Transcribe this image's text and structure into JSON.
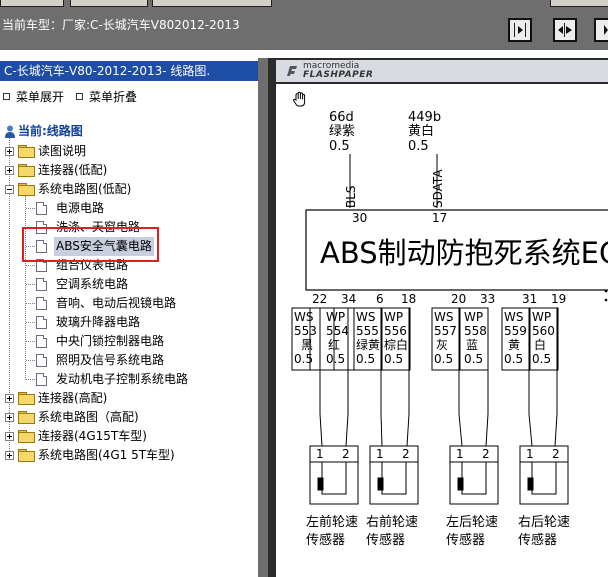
{
  "top": {
    "vehicle_text": "当前车型：厂家:C-长城汽车V802012-2013"
  },
  "tree": {
    "header": "C-长城汽车-V80-2012-2013- 线路图.",
    "expand_all": "菜单展开",
    "collapse_all": "菜单折叠",
    "current": "当前:线路图",
    "items": [
      {
        "label": "读图说明"
      },
      {
        "label": "连接器(低配)"
      },
      {
        "label": "系统电路图(低配)"
      },
      {
        "label": "电源电路"
      },
      {
        "label": "洗涤、天窗电路"
      },
      {
        "label": "ABS安全气囊电路"
      },
      {
        "label": "组合仪表电路"
      },
      {
        "label": "空调系统电路"
      },
      {
        "label": "音响、电动后视镜电路"
      },
      {
        "label": "玻璃升降器电路"
      },
      {
        "label": "中央门锁控制器电路"
      },
      {
        "label": "照明及信号系统电路"
      },
      {
        "label": "发动机电子控制系统电路"
      },
      {
        "label": "连接器(高配)"
      },
      {
        "label": "系统电路图（高配)"
      },
      {
        "label": "连接器(4G15T车型)"
      },
      {
        "label": "系统电路图(4G1 5T车型)"
      }
    ]
  },
  "viewer": {
    "brand_top": "macromedia",
    "brand_bottom": "FLASHPAPER"
  },
  "diagram": {
    "module_title": "ABS制动防抱死系统EC",
    "top_wires": [
      {
        "num": "66d",
        "color": "绿紫",
        "gauge": "0.5",
        "signal": "BLS",
        "pin": "30"
      },
      {
        "num": "449b",
        "color": "黄白",
        "gauge": "0.5",
        "signal": "SDATA",
        "pin": "17"
      }
    ],
    "bottom_pins": [
      "22",
      "34",
      "6",
      "18",
      "20",
      "33",
      "31",
      "19"
    ],
    "wires": [
      {
        "type": "WS",
        "num": "553",
        "color": "黑",
        "gauge": "0.5"
      },
      {
        "type": "WP",
        "num": "554",
        "color": "红",
        "gauge": "0.5"
      },
      {
        "type": "WS",
        "num": "555",
        "color": "绿黄",
        "gauge": "0.5"
      },
      {
        "type": "WP",
        "num": "556",
        "color": "棕白",
        "gauge": "0.5"
      },
      {
        "type": "WS",
        "num": "557",
        "color": "灰",
        "gauge": "0.5"
      },
      {
        "type": "WP",
        "num": "558",
        "color": "蓝",
        "gauge": "0.5"
      },
      {
        "type": "WS",
        "num": "559",
        "color": "黄",
        "gauge": "0.5"
      },
      {
        "type": "WP",
        "num": "560",
        "color": "白",
        "gauge": "0.5"
      }
    ],
    "sensor_pins": [
      "1",
      "2"
    ],
    "sensors": [
      {
        "line1": "左前轮速",
        "line2": "传感器"
      },
      {
        "line1": "右前轮速",
        "line2": "传感器"
      },
      {
        "line1": "左后轮速",
        "line2": "传感器"
      },
      {
        "line1": "右后轮速",
        "line2": "传感器"
      }
    ]
  }
}
